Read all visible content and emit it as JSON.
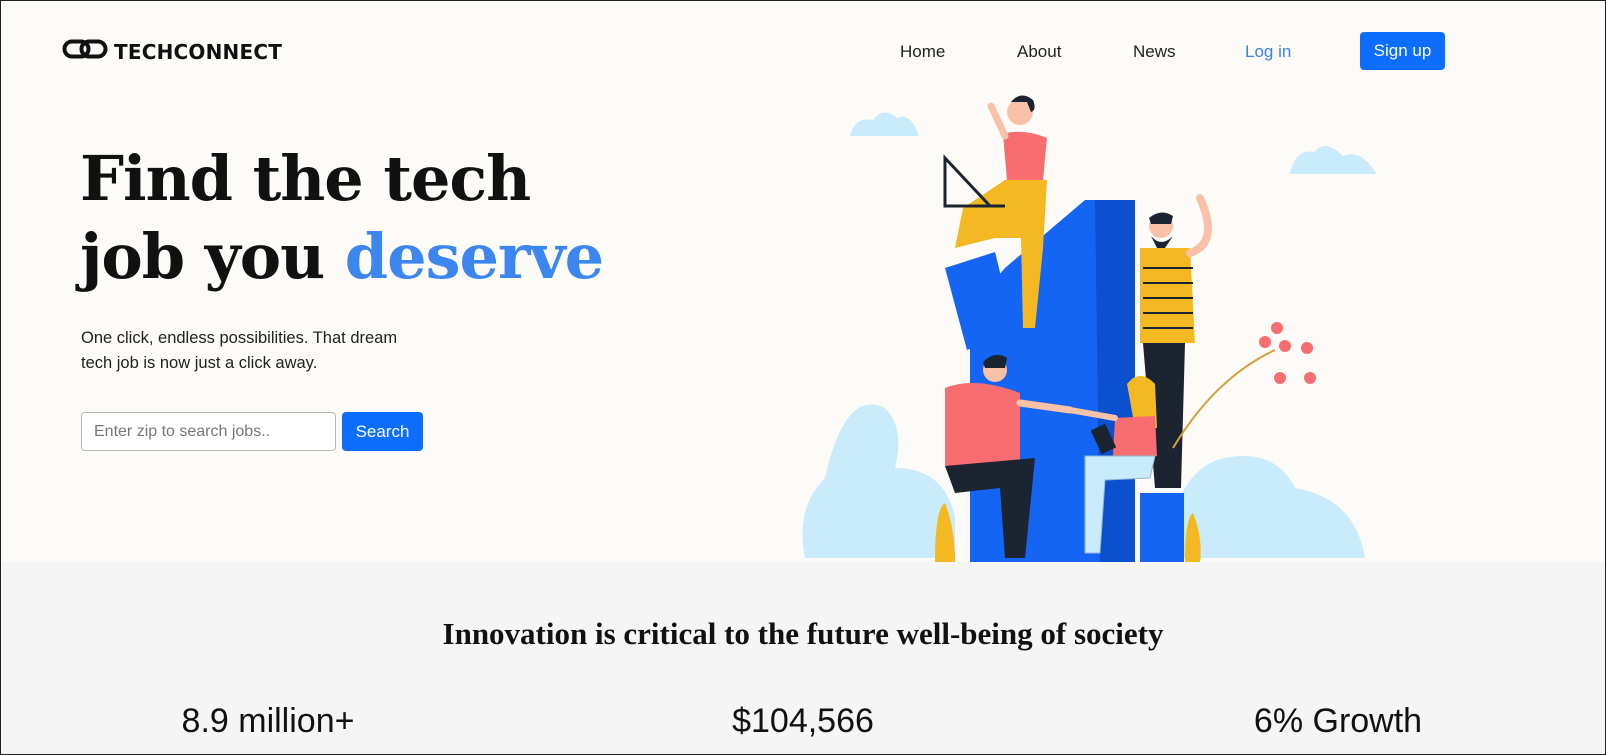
{
  "brand": {
    "name": "TECHCONNECT"
  },
  "nav": {
    "home": "Home",
    "about": "About",
    "news": "News",
    "login": "Log in",
    "signup": "Sign up"
  },
  "hero": {
    "title_line1": "Find the tech",
    "title_line2_prefix": "job you ",
    "title_line2_accent": "deserve",
    "subtitle": "One click, endless possibilities. That dream tech job is now just a click away.",
    "search_placeholder": "Enter zip to search jobs..",
    "search_button": "Search"
  },
  "stats_section": {
    "tagline": "Innovation is critical to the future well-being of society",
    "stats": [
      "8.9 million+",
      "$104,566",
      "6% Growth"
    ]
  },
  "colors": {
    "accent": "#3b86ef",
    "button": "#0d6efd",
    "illustration_blue": "#1565f5",
    "illustration_light": "#c9ebfb",
    "illustration_coral": "#f76d70",
    "illustration_yellow": "#f4b922"
  },
  "icons": {
    "logo": "chain-link-icon"
  }
}
